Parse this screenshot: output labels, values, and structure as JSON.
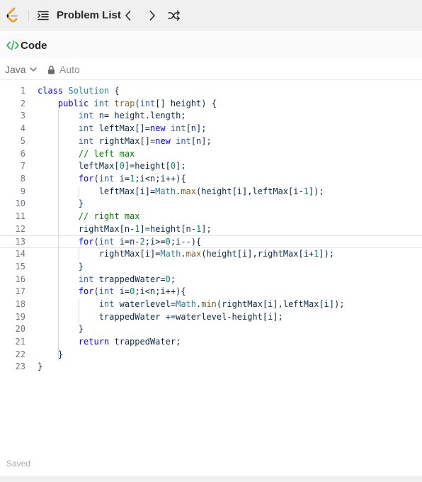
{
  "nav": {
    "logo_icon": "leetcode-logo",
    "list_icon": "problem-list-icon",
    "problem_list_label": "Problem List",
    "prev_icon": "chevron-left-icon",
    "next_icon": "chevron-right-icon",
    "shuffle_icon": "shuffle-icon"
  },
  "panel": {
    "title": "Code",
    "title_icon": "code-brackets-icon",
    "accent_color": "#2db55d"
  },
  "toolbar": {
    "language": "Java",
    "language_icon": "chevron-down-icon",
    "autocomplete_label": "Auto",
    "lock_icon": "lock-icon"
  },
  "editor": {
    "lines": [
      {
        "n": "1",
        "code": "class Solution {"
      },
      {
        "n": "2",
        "code": "    public int trap(int[] height) {"
      },
      {
        "n": "3",
        "code": "        int n= height.length;"
      },
      {
        "n": "4",
        "code": "        int leftMax[]=new int[n];"
      },
      {
        "n": "5",
        "code": "        int rightMax[]=new int[n];"
      },
      {
        "n": "6",
        "code": "        // left max"
      },
      {
        "n": "7",
        "code": "        leftMax[0]=height[0];"
      },
      {
        "n": "8",
        "code": "        for(int i=1;i<n;i++){"
      },
      {
        "n": "9",
        "code": "            leftMax[i]=Math.max(height[i],leftMax[i-1]);"
      },
      {
        "n": "10",
        "code": "        }"
      },
      {
        "n": "11",
        "code": "        // right max"
      },
      {
        "n": "12",
        "code": "        rightMax[n-1]=height[n-1];"
      },
      {
        "n": "13",
        "code": "        for(int i=n-2;i>=0;i--){"
      },
      {
        "n": "14",
        "code": "            rightMax[i]=Math.max(height[i],rightMax[i+1]);"
      },
      {
        "n": "15",
        "code": "        }"
      },
      {
        "n": "16",
        "code": "        int trappedWater=0;"
      },
      {
        "n": "17",
        "code": "        for(int i=0;i<n;i++){"
      },
      {
        "n": "18",
        "code": "            int waterlevel=Math.min(rightMax[i],leftMax[i]);"
      },
      {
        "n": "19",
        "code": "            trappedWater +=waterlevel-height[i];"
      },
      {
        "n": "20",
        "code": "        }"
      },
      {
        "n": "21",
        "code": "        return trappedWater;"
      },
      {
        "n": "22",
        "code": "    }"
      },
      {
        "n": "23",
        "code": "}"
      }
    ],
    "active_line": "13"
  },
  "status": {
    "saved_label": "Saved"
  }
}
